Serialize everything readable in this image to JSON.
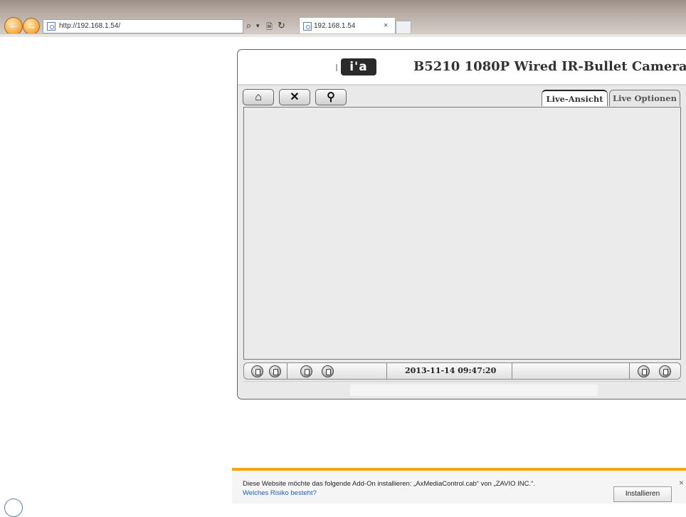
{
  "browser": {
    "address": "http://192.168.1.54/",
    "tab_title": "192.168.1.54",
    "tab_close": "×",
    "search_glyph": "⌕",
    "dropdown_glyph": "▾",
    "compat_glyph": "🗎",
    "refresh_glyph": "↻"
  },
  "header": {
    "logo_text": "i'a",
    "title": "B5210 1080P Wired IR-Bullet Camera"
  },
  "toolbar": {
    "home_glyph": "⌂",
    "tools_glyph": "✕",
    "search_glyph": "⚲"
  },
  "tabs": [
    {
      "label": "Live-Ansicht",
      "active": true
    },
    {
      "label": "Live Optionen",
      "active": false
    }
  ],
  "controls": {
    "datetime": "2013-11-14 09:47:20"
  },
  "infobar": {
    "message": "Diese Website möchte das folgende Add-On installieren: „AxMediaControl.cab“ von „ZAVIO INC.“.",
    "risk_link": "Welches Risiko besteht?",
    "install_label": "Installieren",
    "close_glyph": "×"
  },
  "colors": {
    "infobar_accent": "#f2a60f",
    "nav_button": "#f2a53a"
  }
}
